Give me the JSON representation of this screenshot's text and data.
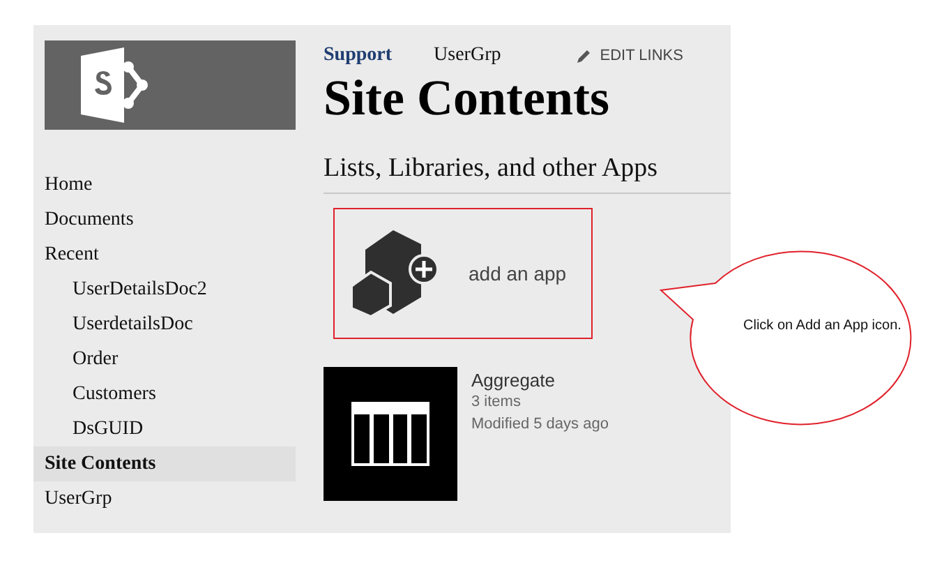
{
  "logo": {
    "kind": "sharepoint"
  },
  "top_nav": [
    {
      "label": "Support",
      "selected": true
    },
    {
      "label": "UserGrp",
      "selected": false
    }
  ],
  "edit_links": "EDIT LINKS",
  "page_title": "Site Contents",
  "quick_launch": [
    {
      "label": "Home",
      "selected": false
    },
    {
      "label": "Documents",
      "selected": false
    },
    {
      "label": "Recent",
      "selected": false,
      "children": [
        {
          "label": "UserDetailsDoc2",
          "selected": false
        },
        {
          "label": "UserdetailsDoc",
          "selected": false
        },
        {
          "label": "Order",
          "selected": false
        },
        {
          "label": "Customers",
          "selected": false
        },
        {
          "label": "DsGUID",
          "selected": false
        }
      ]
    },
    {
      "label": "Site Contents",
      "selected": true
    },
    {
      "label": "UserGrp",
      "selected": false
    }
  ],
  "section_title": "Lists, Libraries, and other Apps",
  "add_app": {
    "label": "add an app",
    "highlighted": true
  },
  "apps": [
    {
      "title": "Aggregate",
      "count": "3 items",
      "modified": "Modified 5 days ago"
    }
  ],
  "callout": {
    "text": "Click on Add an App icon."
  }
}
